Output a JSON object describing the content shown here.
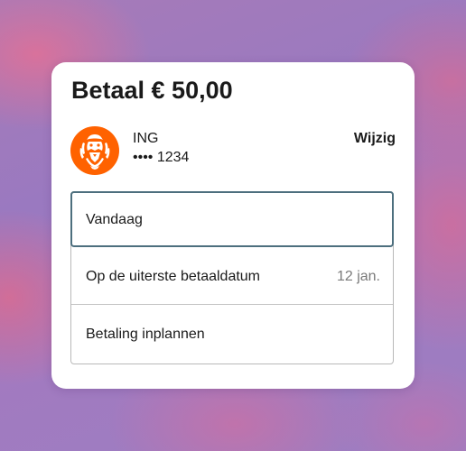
{
  "payment": {
    "title": "Betaal € 50,00"
  },
  "account": {
    "bank_name": "ING",
    "account_number": "•••• 1234",
    "change_label": "Wijzig",
    "logo_icon": "ing-lion-logo",
    "brand_color": "#ff6200"
  },
  "options": {
    "today": {
      "label": "Vandaag",
      "selected": true
    },
    "due_date": {
      "label": "Op de uiterste betaaldatum",
      "date": "12 jan."
    },
    "schedule": {
      "label": "Betaling inplannen"
    }
  },
  "colors": {
    "selected_border": "#4d6f7e",
    "text": "#1a1a1a",
    "secondary_text": "#7a7a7a"
  }
}
